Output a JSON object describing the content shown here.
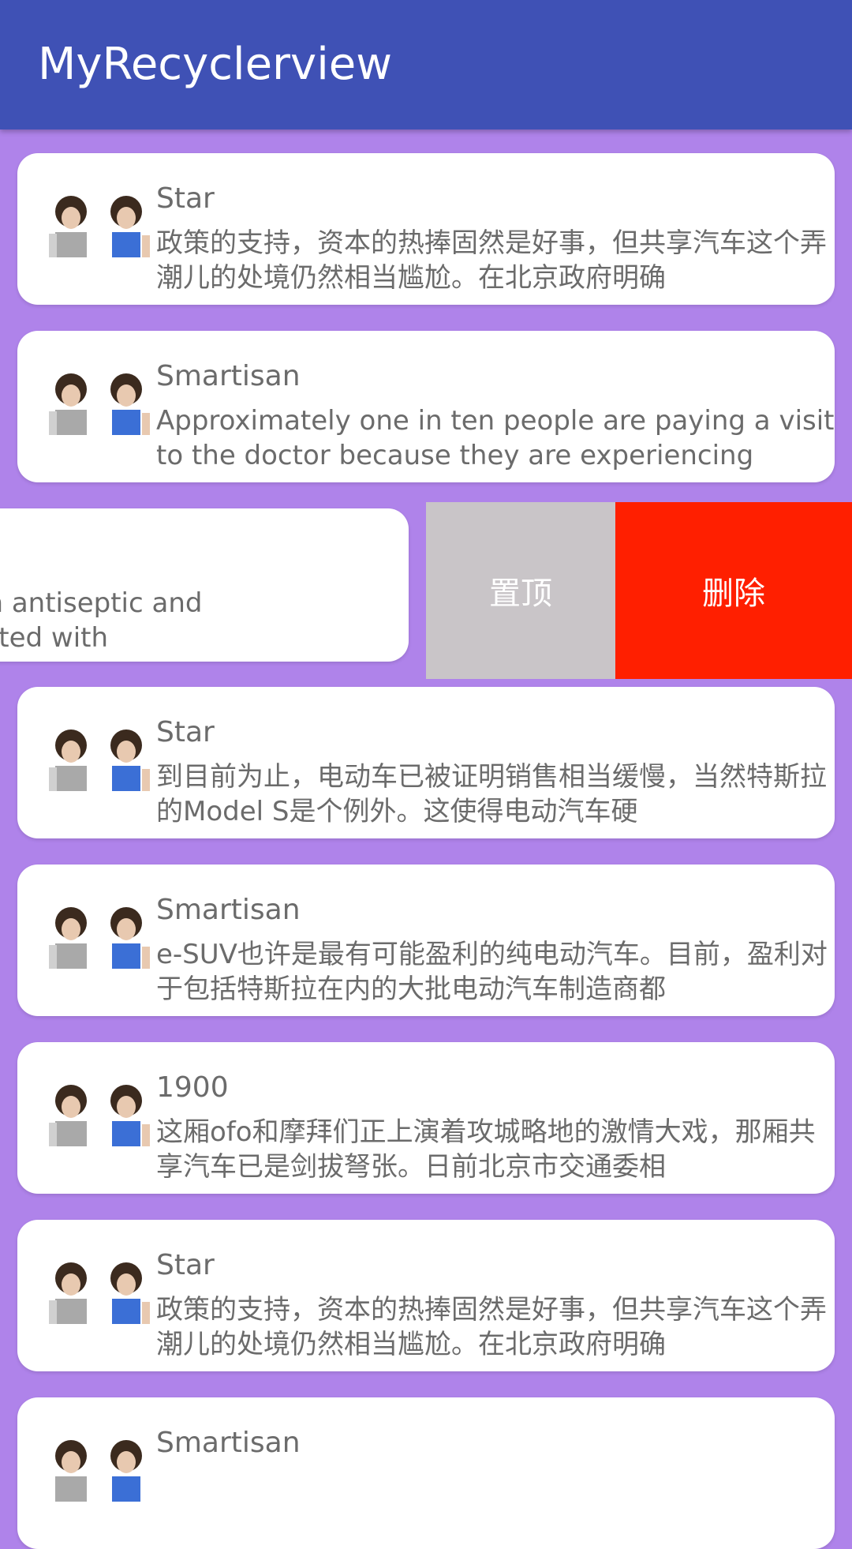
{
  "app_bar": {
    "title": "MyRecyclerview"
  },
  "items": [
    {
      "title": "Star",
      "desc": "政策的支持，资本的热捧固然是好事，但共享汽车这个弄潮儿的处境仍然相当尴尬。在北京政府明确"
    },
    {
      "title": "Smartisan",
      "desc": "Approximately one in ten people are paying a visit to the doctor because they are experiencing"
    },
    {
      "title": "Star",
      "desc": "到目前为止，电动车已被证明销售相当缓慢，当然特斯拉的Model S是个例外。这使得电动汽车硬"
    },
    {
      "title": "Smartisan",
      "desc": "e-SUV也许是最有可能盈利的纯电动汽车。目前，盈利对于包括特斯拉在内的大批电动汽车制造商都"
    },
    {
      "title": "1900",
      "desc": "这厢ofo和摩拜们正上演着攻城略地的激情大戏，那厢共享汽车已是剑拔弩张。日前北京市交通委相"
    },
    {
      "title": "Star",
      "desc": "政策的支持，资本的热捧固然是好事，但共享汽车这个弄潮儿的处境仍然相当尴尬。在北京政府明确"
    },
    {
      "title": "Smartisan",
      "desc": ""
    }
  ],
  "swiped_item": {
    "desc_line1": "e used as an antiseptic and",
    "desc_line2": "pain associated with"
  },
  "swipe_actions": {
    "pin_label": "置顶",
    "delete_label": "删除"
  },
  "colors": {
    "app_bar": "#3f51b5",
    "background": "#af83ea",
    "pin_action": "#c9c5c8",
    "delete_action": "#ff1f00"
  },
  "icons": {
    "avatar": "avatar-image"
  }
}
